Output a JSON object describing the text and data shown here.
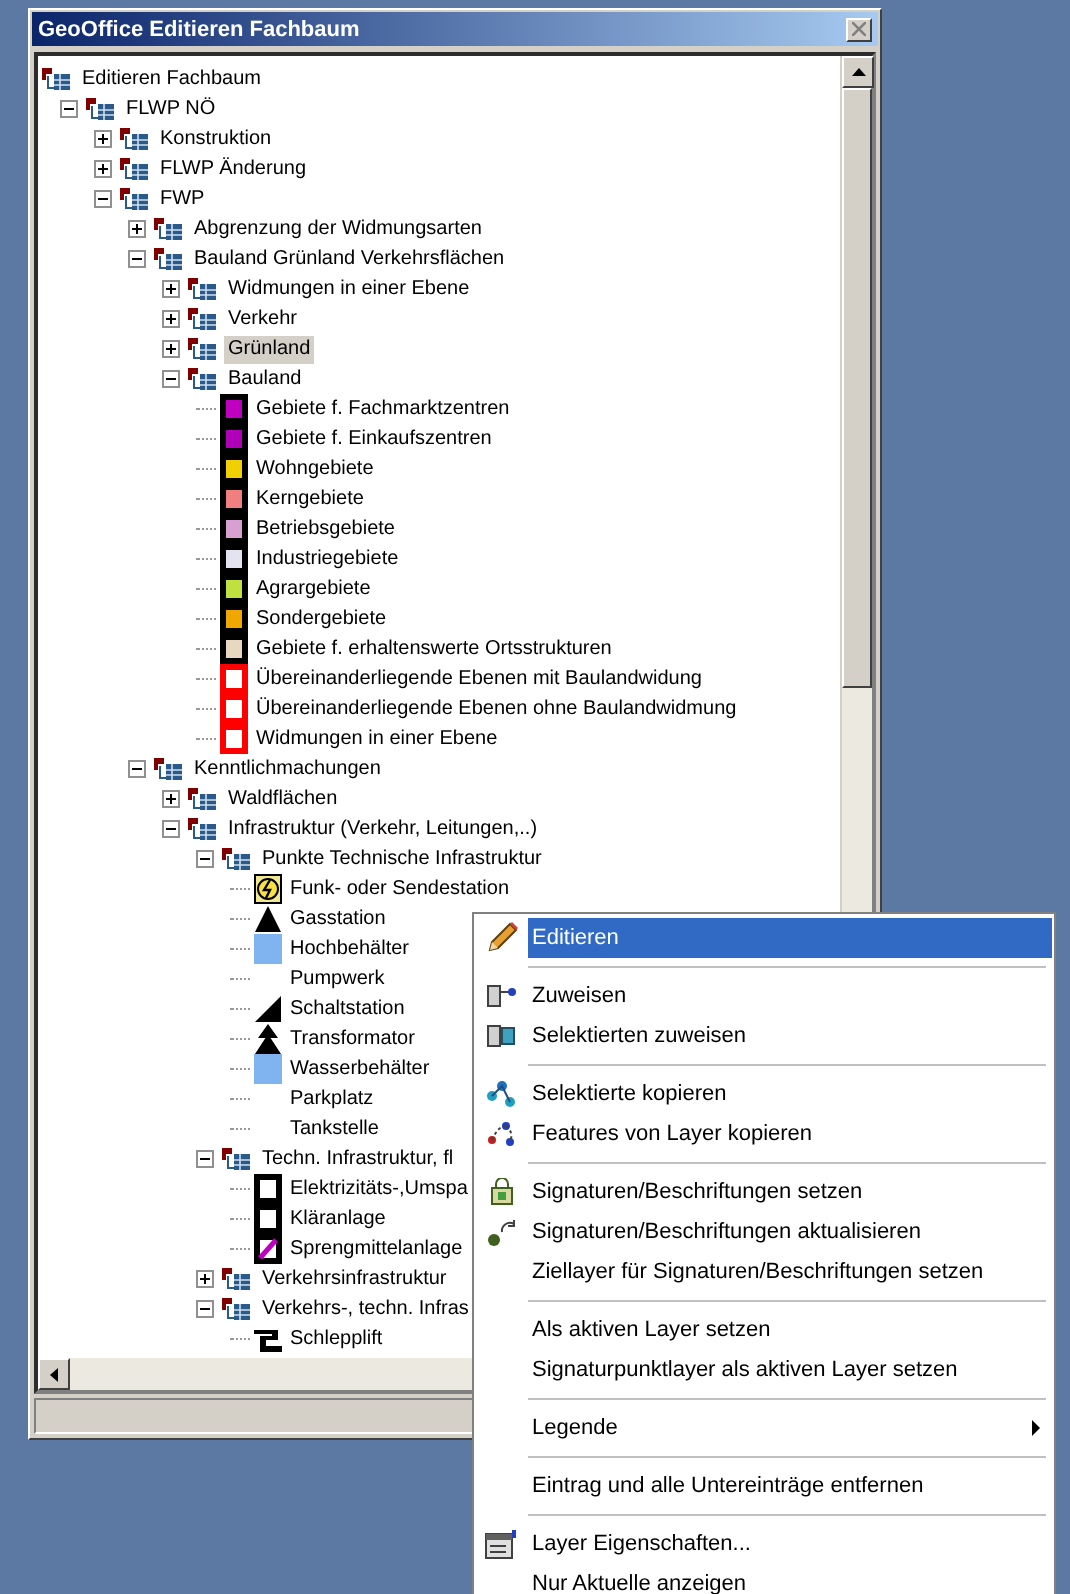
{
  "window": {
    "title": "GeoOffice Editieren Fachbaum"
  },
  "tree": {
    "root": {
      "label": "Editieren Fachbaum",
      "selected": false
    },
    "items": [
      {
        "label": "FLWP NÖ",
        "kind": "group",
        "expanded": true,
        "selected": false,
        "children": [
          {
            "label": "Konstruktion",
            "kind": "group",
            "expanded": false,
            "selected": false
          },
          {
            "label": "FLWP Änderung",
            "kind": "group",
            "expanded": false,
            "selected": false
          },
          {
            "label": "FWP",
            "kind": "group",
            "expanded": true,
            "selected": false,
            "children": [
              {
                "label": "Abgrenzung der Widmungsarten",
                "kind": "group",
                "expanded": false,
                "selected": false
              },
              {
                "label": "Bauland Grünland Verkehrsflächen",
                "kind": "group",
                "expanded": true,
                "selected": false,
                "children": [
                  {
                    "label": "Widmungen in einer Ebene",
                    "kind": "group",
                    "expanded": false,
                    "selected": false
                  },
                  {
                    "label": "Verkehr",
                    "kind": "group",
                    "expanded": false,
                    "selected": false
                  },
                  {
                    "label": "Grünland",
                    "kind": "group",
                    "expanded": false,
                    "selected": true
                  },
                  {
                    "label": "Bauland",
                    "kind": "group",
                    "expanded": true,
                    "selected": false,
                    "children": [
                      {
                        "label": "Gebiete f. Fachmarktzentren",
                        "kind": "swatch",
                        "color": "#c000c0",
                        "selected": false
                      },
                      {
                        "label": "Gebiete f. Einkaufszentren",
                        "kind": "swatch",
                        "color": "#b000b8",
                        "selected": false
                      },
                      {
                        "label": "Wohngebiete",
                        "kind": "swatch",
                        "color": "#f0d000",
                        "selected": false
                      },
                      {
                        "label": "Kerngebiete",
                        "kind": "swatch",
                        "color": "#f08080",
                        "selected": false
                      },
                      {
                        "label": "Betriebsgebiete",
                        "kind": "swatch",
                        "color": "#d8a0d0",
                        "selected": false
                      },
                      {
                        "label": "Industriegebiete",
                        "kind": "swatch",
                        "color": "#e4e4f0",
                        "selected": false
                      },
                      {
                        "label": "Agrargebiete",
                        "kind": "swatch",
                        "color": "#c0e040",
                        "selected": false
                      },
                      {
                        "label": "Sondergebiete",
                        "kind": "swatch",
                        "color": "#f0a800",
                        "selected": false
                      },
                      {
                        "label": "Gebiete f. erhaltenswerte Ortsstrukturen",
                        "kind": "swatch",
                        "color": "#e8d8c0",
                        "selected": false
                      },
                      {
                        "label": "Übereinanderliegende Ebenen mit Baulandwidung",
                        "kind": "outline",
                        "color": "#ff0000",
                        "selected": false
                      },
                      {
                        "label": "Übereinanderliegende Ebenen ohne Baulandwidmung",
                        "kind": "outline",
                        "color": "#ff0000",
                        "selected": false
                      },
                      {
                        "label": "Widmungen in einer Ebene",
                        "kind": "outline",
                        "color": "#ff0000",
                        "selected": false
                      }
                    ]
                  }
                ]
              },
              {
                "label": "Kenntlichmachungen",
                "kind": "group",
                "expanded": true,
                "selected": false,
                "children": [
                  {
                    "label": "Waldflächen",
                    "kind": "group",
                    "expanded": false,
                    "selected": false
                  },
                  {
                    "label": "Infrastruktur (Verkehr, Leitungen,..)",
                    "kind": "group",
                    "expanded": true,
                    "selected": false,
                    "children": [
                      {
                        "label": "Punkte Technische Infrastruktur",
                        "kind": "group",
                        "expanded": true,
                        "selected": false,
                        "children": [
                          {
                            "label": "Funk- oder Sendestation",
                            "kind": "radio",
                            "selected": false
                          },
                          {
                            "label": "Gasstation",
                            "kind": "triangle",
                            "selected": false
                          },
                          {
                            "label": "Hochbehälter",
                            "kind": "square",
                            "color": "#80b4f0",
                            "selected": false
                          },
                          {
                            "label": "Pumpwerk",
                            "kind": "blank",
                            "selected": false
                          },
                          {
                            "label": "Schaltstation",
                            "kind": "wedge",
                            "selected": false
                          },
                          {
                            "label": "Transformator",
                            "kind": "double-triangle",
                            "selected": false
                          },
                          {
                            "label": "Wasserbehälter",
                            "kind": "square",
                            "color": "#80b4f0",
                            "selected": false
                          },
                          {
                            "label": "Parkplatz",
                            "kind": "blank",
                            "selected": false
                          },
                          {
                            "label": "Tankstelle",
                            "kind": "blank",
                            "selected": false
                          }
                        ]
                      },
                      {
                        "label": "Techn. Infrastruktur, fl",
                        "kind": "group",
                        "expanded": true,
                        "selected": false,
                        "children": [
                          {
                            "label": "Elektrizitäts-,Umspa",
                            "kind": "box",
                            "selected": false
                          },
                          {
                            "label": "Kläranlage",
                            "kind": "box",
                            "selected": false
                          },
                          {
                            "label": "Sprengmittelanlage",
                            "kind": "hatched",
                            "selected": false
                          }
                        ]
                      },
                      {
                        "label": "Verkehrsinfrastruktur",
                        "kind": "group",
                        "expanded": false,
                        "selected": false
                      },
                      {
                        "label": "Verkehrs-, techn. Infras",
                        "kind": "group",
                        "expanded": true,
                        "selected": false,
                        "children": [
                          {
                            "label": "Schlepplift",
                            "kind": "lift",
                            "selected": false
                          }
                        ]
                      }
                    ]
                  }
                ]
              }
            ]
          }
        ]
      }
    ]
  },
  "context_menu": [
    {
      "kind": "item",
      "label": "Editieren",
      "selected": true,
      "submenu": false
    },
    {
      "kind": "separator"
    },
    {
      "kind": "item",
      "label": "Zuweisen",
      "selected": false,
      "submenu": false
    },
    {
      "kind": "item",
      "label": "Selektierten zuweisen",
      "selected": false,
      "submenu": false
    },
    {
      "kind": "separator"
    },
    {
      "kind": "item",
      "label": "Selektierte kopieren",
      "selected": false,
      "submenu": false
    },
    {
      "kind": "item",
      "label": "Features von Layer kopieren",
      "selected": false,
      "submenu": false
    },
    {
      "kind": "separator"
    },
    {
      "kind": "item",
      "label": "Signaturen/Beschriftungen setzen",
      "selected": false,
      "submenu": false
    },
    {
      "kind": "item",
      "label": "Signaturen/Beschriftungen aktualisieren",
      "selected": false,
      "submenu": false
    },
    {
      "kind": "item",
      "label": "Ziellayer für Signaturen/Beschriftungen setzen",
      "selected": false,
      "submenu": false
    },
    {
      "kind": "separator"
    },
    {
      "kind": "item",
      "label": "Als aktiven Layer setzen",
      "selected": false,
      "submenu": false
    },
    {
      "kind": "item",
      "label": "Signaturpunktlayer als aktiven Layer setzen",
      "selected": false,
      "submenu": false
    },
    {
      "kind": "separator"
    },
    {
      "kind": "item",
      "label": "Legende",
      "selected": false,
      "submenu": true
    },
    {
      "kind": "separator"
    },
    {
      "kind": "item",
      "label": "Eintrag und alle Untereinträge entfernen",
      "selected": false,
      "submenu": false
    },
    {
      "kind": "separator"
    },
    {
      "kind": "item",
      "label": "Layer Eigenschaften...",
      "selected": false,
      "submenu": false
    },
    {
      "kind": "item",
      "label": "Nur Aktuelle anzeigen",
      "selected": false,
      "submenu": false
    }
  ]
}
